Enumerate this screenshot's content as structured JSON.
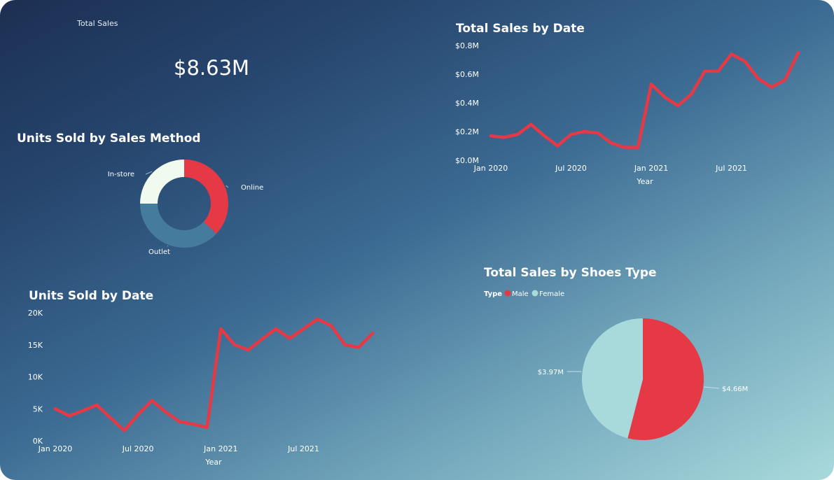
{
  "kpi": {
    "label": "Total Sales",
    "value": "$8.63M"
  },
  "colors": {
    "accent_red": "#e63946",
    "instore": "#f1faee",
    "outlet": "#457b9d",
    "female": "#a8dadc",
    "male": "#e63946"
  },
  "chart_data": [
    {
      "id": "sales_by_date",
      "type": "line",
      "title": "Total Sales by Date",
      "xlabel": "Year",
      "ylabel": "",
      "ylim": [
        0,
        0.8
      ],
      "y_ticks": [
        "$0.0M",
        "$0.2M",
        "$0.4M",
        "$0.6M",
        "$0.8M"
      ],
      "x_ticks": [
        "Jan 2020",
        "Jul 2020",
        "Jan 2021",
        "Jul 2021"
      ],
      "x": [
        "Jan 2020",
        "Feb 2020",
        "Mar 2020",
        "Apr 2020",
        "May 2020",
        "Jun 2020",
        "Jul 2020",
        "Aug 2020",
        "Sep 2020",
        "Oct 2020",
        "Nov 2020",
        "Dec 2020",
        "Jan 2021",
        "Feb 2021",
        "Mar 2021",
        "Apr 2021",
        "May 2021",
        "Jun 2021",
        "Jul 2021",
        "Aug 2021",
        "Sep 2021",
        "Oct 2021",
        "Nov 2021",
        "Dec 2021"
      ],
      "series": [
        {
          "values": [
            0.17,
            0.16,
            0.18,
            0.25,
            0.17,
            0.1,
            0.18,
            0.2,
            0.19,
            0.12,
            0.09,
            0.09,
            0.53,
            0.44,
            0.38,
            0.46,
            0.62,
            0.62,
            0.74,
            0.69,
            0.57,
            0.51,
            0.56,
            0.75
          ]
        }
      ]
    },
    {
      "id": "units_by_date",
      "type": "line",
      "title": "Units Sold by Date",
      "xlabel": "Year",
      "ylabel": "",
      "ylim": [
        0,
        20000
      ],
      "y_ticks": [
        "0K",
        "5K",
        "10K",
        "15K",
        "20K"
      ],
      "x_ticks": [
        "Jan 2020",
        "Jul 2020",
        "Jan 2021",
        "Jul 2021"
      ],
      "x": [
        "Jan 2020",
        "Feb 2020",
        "Mar 2020",
        "Apr 2020",
        "May 2020",
        "Jun 2020",
        "Jul 2020",
        "Aug 2020",
        "Sep 2020",
        "Oct 2020",
        "Nov 2020",
        "Dec 2020",
        "Jan 2021",
        "Feb 2021",
        "Mar 2021",
        "Apr 2021",
        "May 2021",
        "Jun 2021",
        "Jul 2021",
        "Aug 2021",
        "Sep 2021",
        "Oct 2021",
        "Nov 2021",
        "Dec 2021"
      ],
      "series": [
        {
          "values": [
            5000,
            3900,
            4700,
            5600,
            3600,
            1600,
            4100,
            6300,
            4500,
            3000,
            2600,
            2100,
            17500,
            15000,
            14200,
            15900,
            17500,
            16000,
            17500,
            19000,
            18000,
            15000,
            14600,
            16800
          ]
        }
      ]
    },
    {
      "id": "units_by_method",
      "type": "pie",
      "donut": true,
      "title": "Units Sold by Sales Method",
      "labels": [
        "Online",
        "Outlet",
        "In-store"
      ],
      "values": [
        37,
        38,
        25
      ]
    },
    {
      "id": "sales_by_shoes",
      "type": "pie",
      "title": "Total Sales by Shoes Type",
      "legend_title": "Type",
      "labels": [
        "Male",
        "Female"
      ],
      "values": [
        4.66,
        3.97
      ],
      "data_labels": [
        "$4.66M",
        "$3.97M"
      ]
    }
  ]
}
